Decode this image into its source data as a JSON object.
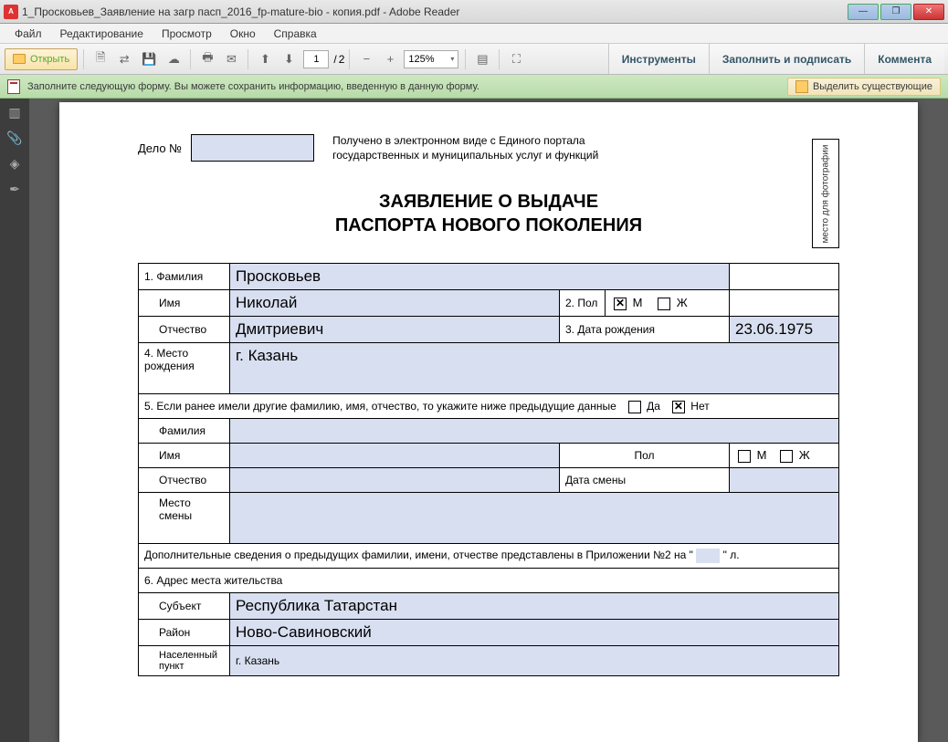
{
  "window": {
    "title": "1_Просковьев_Заявление на загр пасп_2016_fp-mature-bio - копия.pdf - Adobe Reader"
  },
  "menu": {
    "file": "Файл",
    "edit": "Редактирование",
    "view": "Просмотр",
    "window": "Окно",
    "help": "Справка"
  },
  "toolbar": {
    "open": "Открыть",
    "page_current": "1",
    "page_sep": "/",
    "page_total": "2",
    "zoom": "125%",
    "tools": "Инструменты",
    "fill_sign": "Заполнить и подписать",
    "comment": "Коммента"
  },
  "infobar": {
    "message": "Заполните следующую форму. Вы можете сохранить информацию, введенную в данную форму.",
    "highlight": "Выделить существующие"
  },
  "form": {
    "delo_label": "Дело №",
    "received": "Получено в электронном виде с Единого портала государственных и муниципальных услуг и функций",
    "photo_label": "место для фотографии",
    "title_line1": "ЗАЯВЛЕНИЕ О ВЫДАЧЕ",
    "title_line2": "ПАСПОРТА НОВОГО ПОКОЛЕНИЯ",
    "row1_label": "1. Фамилия",
    "surname": "Просковьев",
    "name_label": "Имя",
    "name": "Николай",
    "gender_label": "2. Пол",
    "gender_m": "М",
    "gender_f": "Ж",
    "patronymic_label": "Отчество",
    "patronymic": "Дмитриевич",
    "dob_label": "3. Дата рождения",
    "dob": "23.06.1975",
    "birthplace_label": "4. Место рождения",
    "birthplace": "г. Казань",
    "prev_names_label": "5. Если ранее имели другие фамилию, имя, отчество, то укажите ниже предыдущие данные",
    "yes": "Да",
    "no": "Нет",
    "prev_surname_label": "Фамилия",
    "prev_name_label": "Имя",
    "pol_label": "Пол",
    "prev_patronymic_label": "Отчество",
    "change_date_label": "Дата смены",
    "change_place_label": "Место смены",
    "appendix_text_a": "Дополнительные сведения о предыдущих фамилии, имени, отчестве представлены в Приложении №2 на \"",
    "appendix_text_b": "\" л.",
    "address_header": "6. Адрес места жительства",
    "subject_label": "Субъект",
    "subject": "Республика Татарстан",
    "district_label": "Район",
    "district": "Ново-Савиновский",
    "city_label": "Населенный пункт",
    "city": "г. Казань"
  }
}
